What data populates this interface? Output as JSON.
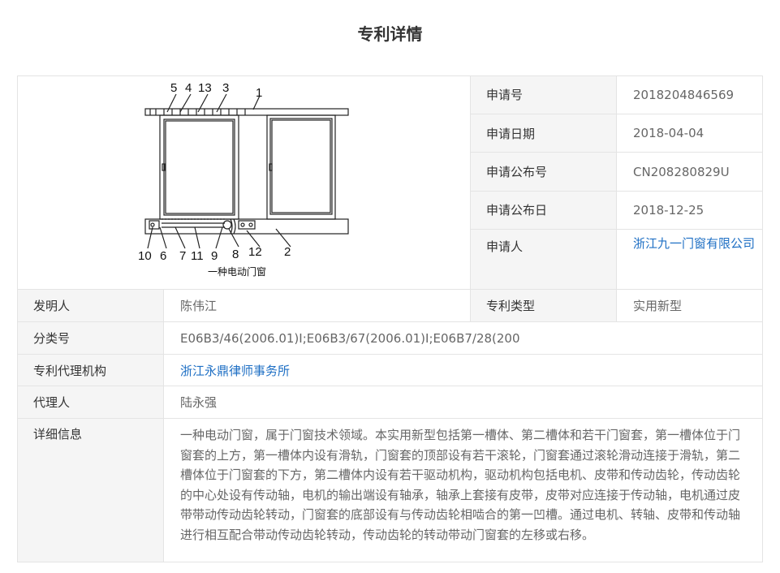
{
  "page": {
    "title": "专利详情"
  },
  "drawing": {
    "caption": "一种电动门窗",
    "part_numbers": [
      "5",
      "4",
      "13",
      "3",
      "1",
      "10",
      "6",
      "7",
      "11",
      "9",
      "8",
      "12",
      "2"
    ]
  },
  "fields": {
    "application_no": {
      "label": "申请号",
      "value": "2018204846569"
    },
    "application_date": {
      "label": "申请日期",
      "value": "2018-04-04"
    },
    "publication_no": {
      "label": "申请公布号",
      "value": "CN208280829U"
    },
    "publication_date": {
      "label": "申请公布日",
      "value": "2018-12-25"
    },
    "applicant": {
      "label": "申请人",
      "value": "浙江九一门窗有限公司"
    },
    "inventor": {
      "label": "发明人",
      "value": "陈伟江"
    },
    "patent_type": {
      "label": "专利类型",
      "value": "实用新型"
    },
    "classification": {
      "label": "分类号",
      "value": "E06B3/46(2006.01)I;E06B3/67(2006.01)I;E06B7/28(200"
    },
    "agency": {
      "label": "专利代理机构",
      "value": "浙江永鼎律师事务所"
    },
    "agent": {
      "label": "代理人",
      "value": "陆永强"
    },
    "details": {
      "label": "详细信息",
      "value": "一种电动门窗，属于门窗技术领域。本实用新型包括第一槽体、第二槽体和若干门窗套，第一槽体位于门窗套的上方，第一槽体内设有滑轨，门窗套的顶部设有若干滚轮，门窗套通过滚轮滑动连接于滑轨，第二槽体位于门窗套的下方，第二槽体内设有若干驱动机构，驱动机构包括电机、皮带和传动齿轮，传动齿轮的中心处设有传动轴，电机的输出端设有轴承，轴承上套接有皮带，皮带对应连接于传动轴，电机通过皮带带动传动齿轮转动，门窗套的底部设有与传动齿轮相啮合的第一凹槽。通过电机、转轴、皮带和传动轴进行相互配合带动传动齿轮转动，传动齿轮的转动带动门窗套的左移或右移。"
    }
  }
}
